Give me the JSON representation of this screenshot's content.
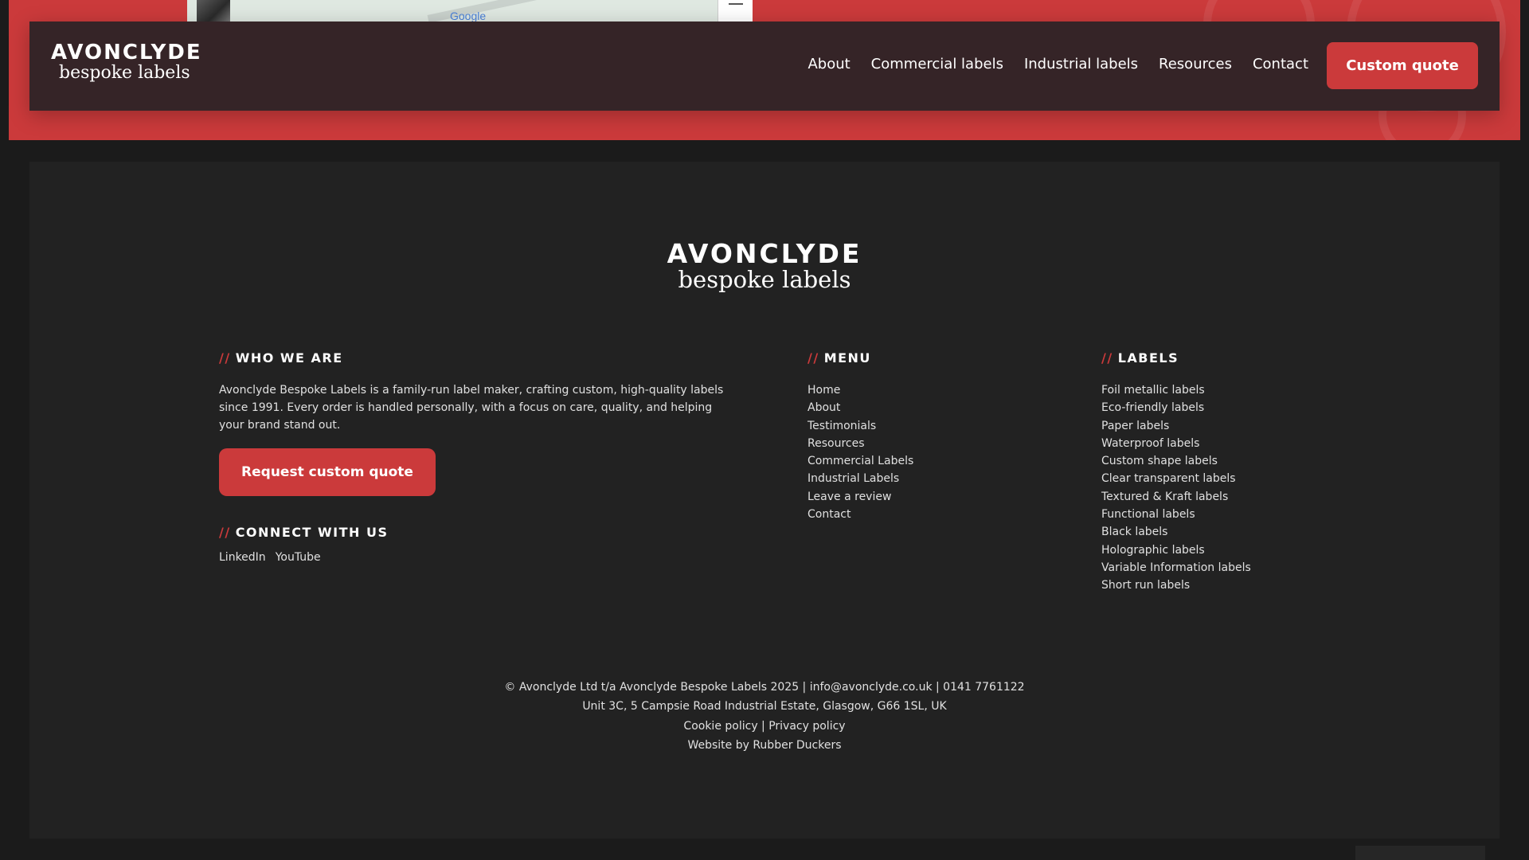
{
  "header": {
    "logo_line1": "AVONCLYDE",
    "logo_line2": "bespoke labels",
    "nav": [
      "About",
      "Commercial labels",
      "Industrial labels",
      "Resources",
      "Contact"
    ],
    "cta_label": "Custom quote",
    "map_attribution": "Google"
  },
  "footer": {
    "logo_line1": "AVONCLYDE",
    "logo_line2": "bespoke labels",
    "slash": "//",
    "who_title": "WHO WE ARE",
    "who_text": "Avonclyde Bespoke Labels is a family-run label maker, crafting custom, high-quality labels since 1991. Every order is handled personally, with a focus on care, quality, and helping your brand stand out.",
    "quote_button": "Request custom quote",
    "connect_title": "CONNECT WITH US",
    "social": [
      "LinkedIn",
      "YouTube"
    ],
    "menu_title": "MENU",
    "menu": [
      "Home",
      "About",
      "Testimonials",
      "Resources",
      "Commercial Labels",
      "Industrial Labels",
      "Leave a review",
      "Contact"
    ],
    "labels_title": "LABELS",
    "labels": [
      "Foil metallic labels",
      "Eco-friendly labels",
      "Paper labels",
      "Waterproof labels",
      "Custom shape labels",
      "Clear transparent labels",
      "Textured & Kraft labels",
      "Functional labels",
      "Black labels",
      "Holographic labels",
      "Variable Information labels",
      "Short run labels"
    ],
    "legal": {
      "copyright": "© Avonclyde Ltd t/a Avonclyde Bespoke Labels 2025 | info@avonclyde.co.uk | 0141 7761122",
      "address": "Unit 3C, 5 Campsie Road Industrial Estate, Glasgow, G66 1SL, UK",
      "policies": "Cookie policy | Privacy policy",
      "credit": "Website by Rubber Duckers"
    }
  },
  "colors": {
    "brand_red": "#cb3a3b",
    "header_bg": "#352427",
    "footer_bg": "#222222",
    "page_bg": "#1b1b1b"
  }
}
